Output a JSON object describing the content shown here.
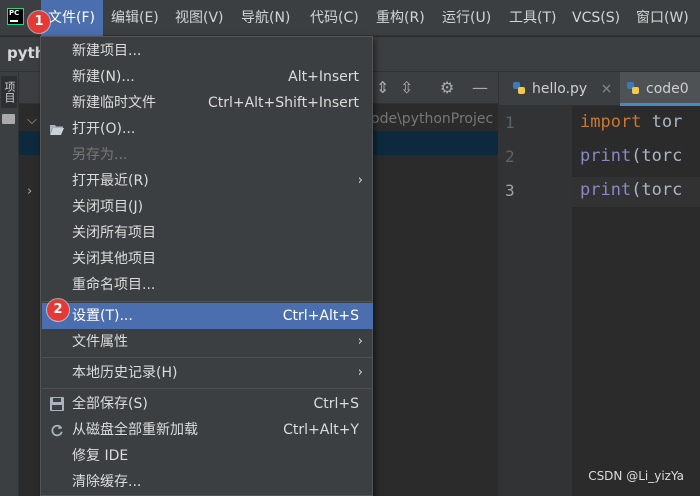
{
  "menubar": {
    "items": [
      "文件(F)",
      "编辑(E)",
      "视图(V)",
      "导航(N)",
      "代码(C)",
      "重构(R)",
      "运行(U)",
      "工具(T)",
      "VCS(S)",
      "窗口(W)"
    ]
  },
  "badges": {
    "step1": "1",
    "step2": "2"
  },
  "project": {
    "name": "pyth",
    "path": "ode\\pythonProjec",
    "tool_window_label": "项目"
  },
  "editor": {
    "tabs": [
      "hello.py",
      "code0"
    ],
    "line_numbers": [
      "1",
      "2",
      "3"
    ],
    "code": {
      "l1_kw": "import",
      "l1_rest": " tor",
      "l2_fn": "print",
      "l2_rest": "(torc",
      "l3_fn": "print",
      "l3_rest": "(torc"
    }
  },
  "file_menu": {
    "items": [
      {
        "label": "新建项目...",
        "shortcut": ""
      },
      {
        "label": "新建(N)...",
        "shortcut": "Alt+Insert"
      },
      {
        "label": "新建临时文件",
        "shortcut": "Ctrl+Alt+Shift+Insert"
      },
      {
        "label": "打开(O)...",
        "shortcut": ""
      },
      {
        "label": "另存为...",
        "shortcut": ""
      },
      {
        "label": "打开最近(R)",
        "shortcut": ""
      },
      {
        "label": "关闭项目(J)",
        "shortcut": ""
      },
      {
        "label": "关闭所有项目",
        "shortcut": ""
      },
      {
        "label": "关闭其他项目",
        "shortcut": ""
      },
      {
        "label": "重命名项目...",
        "shortcut": ""
      },
      {
        "label": "设置(T)...",
        "shortcut": "Ctrl+Alt+S"
      },
      {
        "label": "文件属性",
        "shortcut": ""
      },
      {
        "label": "本地历史记录(H)",
        "shortcut": ""
      },
      {
        "label": "全部保存(S)",
        "shortcut": "Ctrl+S"
      },
      {
        "label": "从磁盘全部重新加载",
        "shortcut": "Ctrl+Alt+Y"
      },
      {
        "label": "修复 IDE",
        "shortcut": ""
      },
      {
        "label": "清除缓存...",
        "shortcut": ""
      }
    ]
  },
  "watermark": "CSDN @Li_yizYa",
  "colors": {
    "accent": "#4b6eaf",
    "badge": "#e53935",
    "background": "#2b2b2b",
    "panel": "#3c3f41"
  }
}
